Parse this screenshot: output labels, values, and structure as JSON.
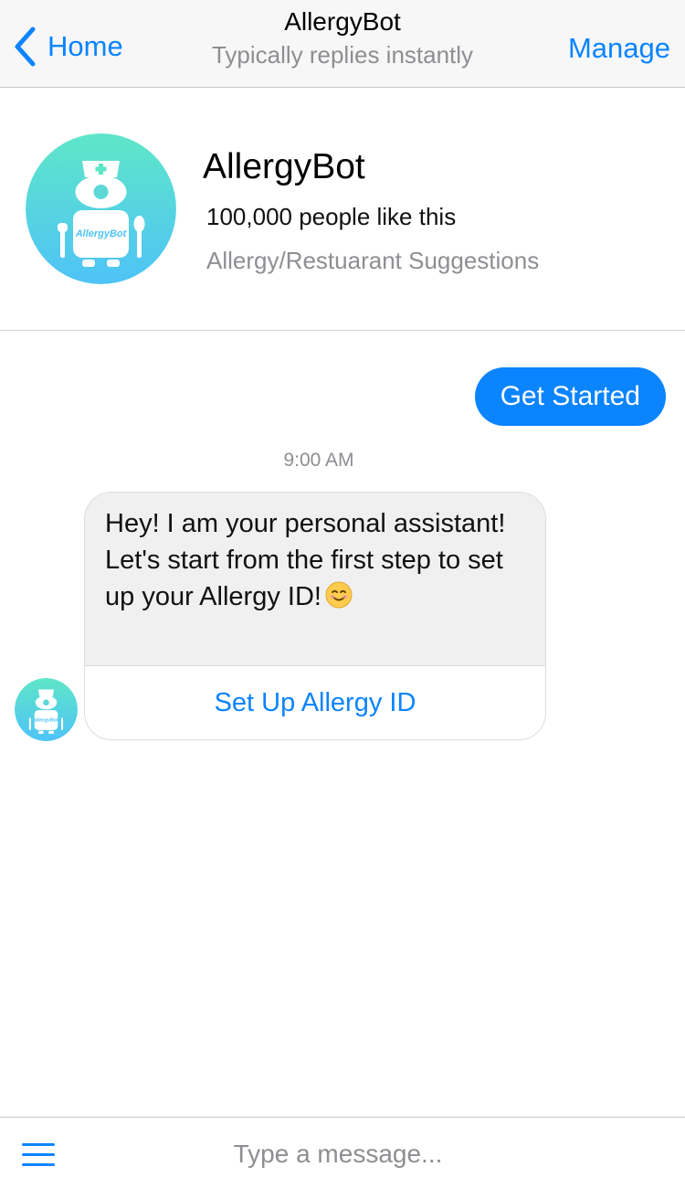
{
  "navbar": {
    "back_label": "Home",
    "title": "AllergyBot",
    "subtitle": "Typically replies instantly",
    "manage_label": "Manage",
    "back_icon": "chevron-left-icon"
  },
  "profile": {
    "name": "AllergyBot",
    "likes": "100,000 people like this",
    "category": "Allergy/Restuarant Suggestions",
    "avatar_text": "AllergyBot"
  },
  "chat": {
    "user_message": "Get Started",
    "timestamp": "9:00 AM",
    "bot_message": "Hey! I am your personal assistant! Let's start from the first step to set up your Allergy ID!",
    "bot_button_label": "Set Up Allergy ID",
    "bot_avatar_text": "allergyBot"
  },
  "composer": {
    "placeholder": "Type a message...",
    "menu_icon": "hamburger-menu-icon"
  },
  "colors": {
    "accent": "#0a84ff",
    "avatar_gradient_top": "#5ee6c8",
    "avatar_gradient_bottom": "#4fc3f7"
  }
}
